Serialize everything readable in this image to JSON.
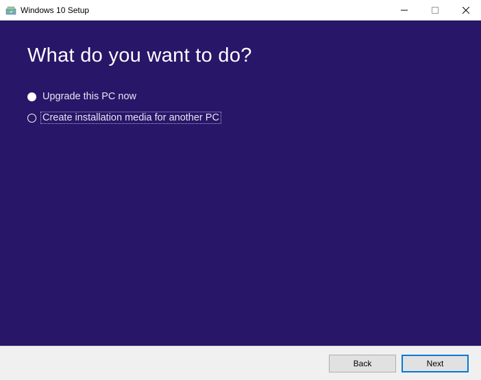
{
  "window": {
    "title": "Windows 10 Setup"
  },
  "content": {
    "heading": "What do you want to do?",
    "options": [
      {
        "label": "Upgrade this PC now",
        "selected": false
      },
      {
        "label": "Create installation media for another PC",
        "selected": true
      }
    ]
  },
  "footer": {
    "back": "Back",
    "next": "Next"
  }
}
